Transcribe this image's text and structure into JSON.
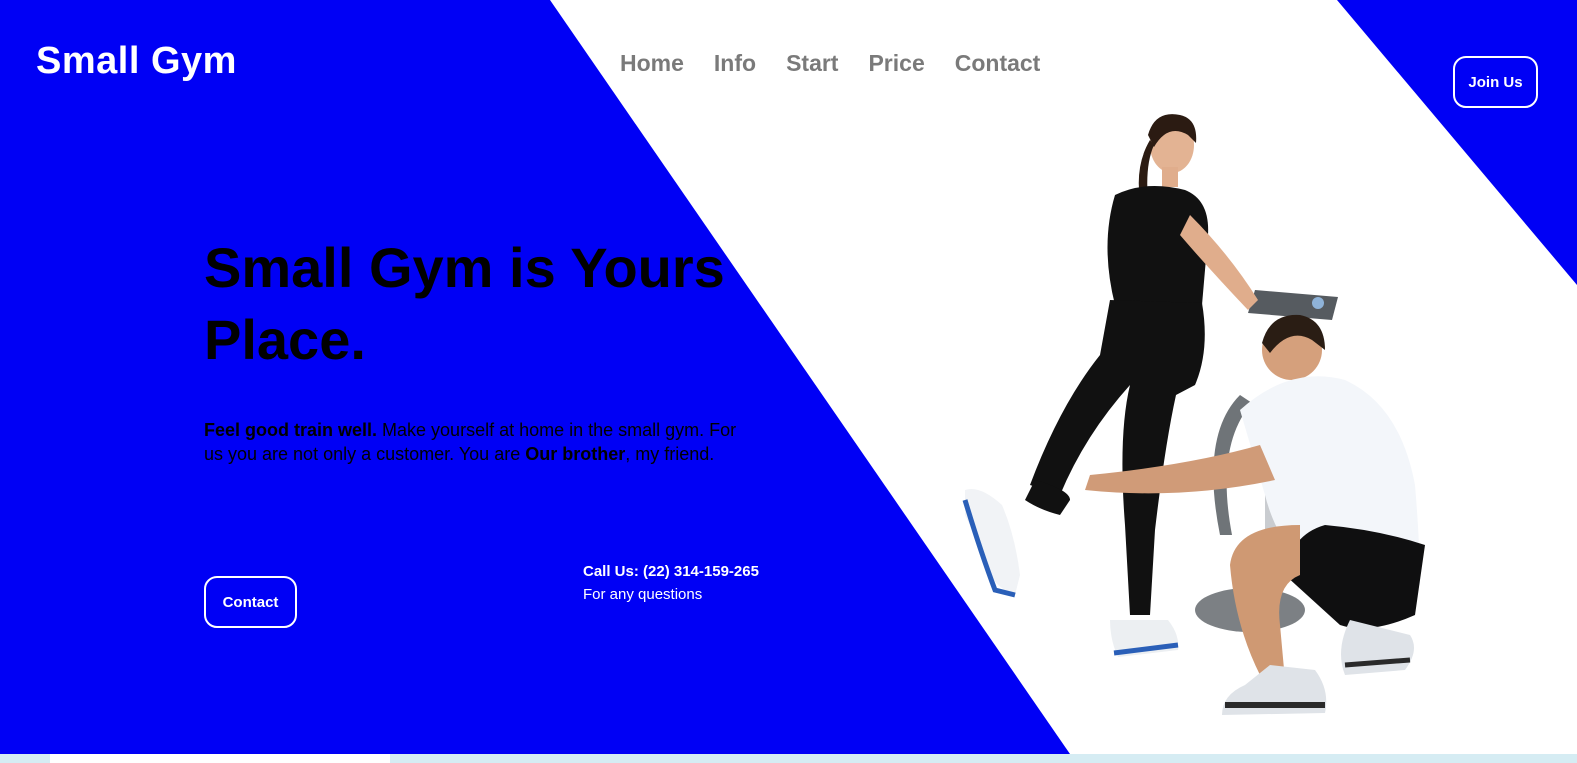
{
  "colors": {
    "primary_blue": "#0000f5",
    "white": "#ffffff",
    "nav_gray": "#7a7a7a",
    "text_dark": "#000000"
  },
  "header": {
    "brand": "Small Gym",
    "nav": [
      "Home",
      "Info",
      "Start",
      "Price",
      "Contact"
    ],
    "cta_label": "Join Us"
  },
  "hero": {
    "headline_line1": "Small Gym is Yours",
    "headline_line2": "Place.",
    "intro_bold_1": "Feel good train well.",
    "intro_text_1": " Make yourself at home in the small gym. For us you are not only a customer. You are ",
    "intro_bold_2": "Our brother",
    "intro_text_2": ", my friend.",
    "contact_button": "Contact",
    "call_label": "Call Us: (22) 314-159-265",
    "call_sub": "For any questions"
  },
  "image": {
    "subject": "woman-training-with-ems-suit-and-trainer"
  }
}
